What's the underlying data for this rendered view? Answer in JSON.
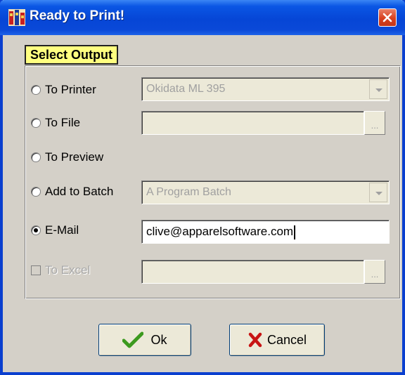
{
  "window": {
    "title": "Ready to Print!"
  },
  "section": {
    "label": "Select Output"
  },
  "options": {
    "printer": {
      "label": "To Printer",
      "value": "Okidata ML 395"
    },
    "file": {
      "label": "To File",
      "value": "",
      "button": "..."
    },
    "preview": {
      "label": "To Preview"
    },
    "batch": {
      "label": "Add to Batch",
      "value": "A Program Batch"
    },
    "email": {
      "label": "E-Mail",
      "value": "clive@apparelsoftware.com",
      "selected": true
    },
    "excel": {
      "label": "To Excel",
      "value": "",
      "button": "..."
    }
  },
  "buttons": {
    "ok": "Ok",
    "cancel": "Cancel"
  },
  "colors": {
    "title_bar": "#0646d6",
    "section_label_bg": "#ffff80",
    "ok_check": "#3c9a1e",
    "cancel_x": "#c81414"
  }
}
